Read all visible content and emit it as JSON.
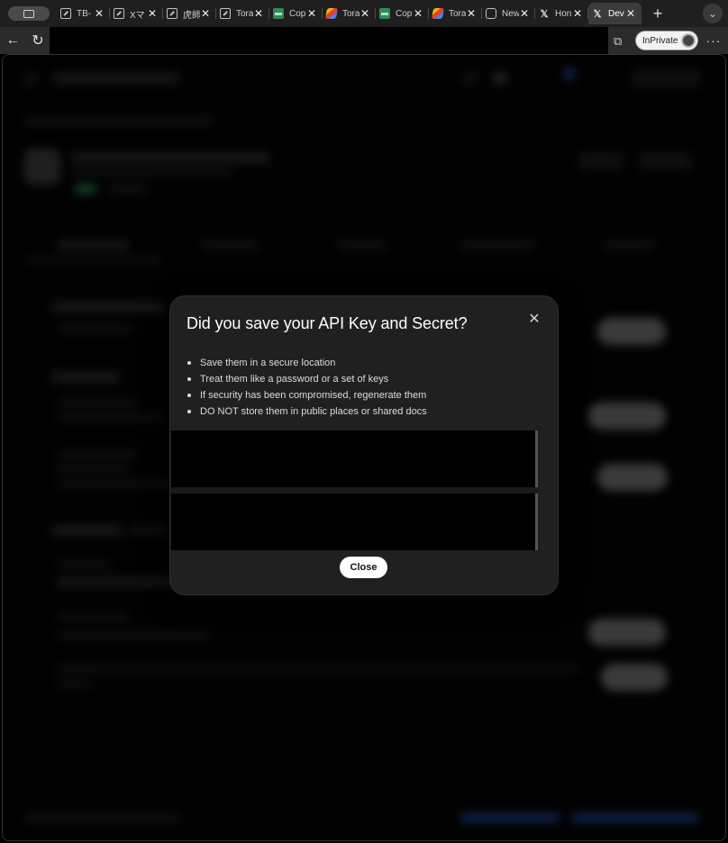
{
  "browser": {
    "tabs": [
      {
        "title": "TB-",
        "icon": "doc-icon"
      },
      {
        "title": "Xマ",
        "icon": "doc-icon"
      },
      {
        "title": "虎師",
        "icon": "doc-icon"
      },
      {
        "title": "Tora",
        "icon": "doc-icon"
      },
      {
        "title": "Cop",
        "icon": "sheet-icon"
      },
      {
        "title": "Tora",
        "icon": "multicolor-icon"
      },
      {
        "title": "Cop",
        "icon": "sheet-icon"
      },
      {
        "title": "Tora",
        "icon": "multicolor-icon"
      },
      {
        "title": "New",
        "icon": "calendar-icon"
      },
      {
        "title": "Hon",
        "icon": "x-logo-icon"
      },
      {
        "title": "Dev",
        "icon": "x-logo-icon",
        "active": true
      }
    ],
    "new_tab_glyph": "+",
    "inprivate_label": "InPrivate"
  },
  "modal": {
    "title": "Did you save your API Key and Secret?",
    "tips": [
      "Save them in a secure location",
      "Treat them like a password or a set of keys",
      "If security has been compromised, regenerate them",
      "DO NOT store them in public places or shared docs"
    ],
    "close_label": "Close"
  },
  "colors": {
    "modal_bg": "#202020",
    "key_box_bg": "#000000",
    "close_button_bg": "#ffffff"
  }
}
